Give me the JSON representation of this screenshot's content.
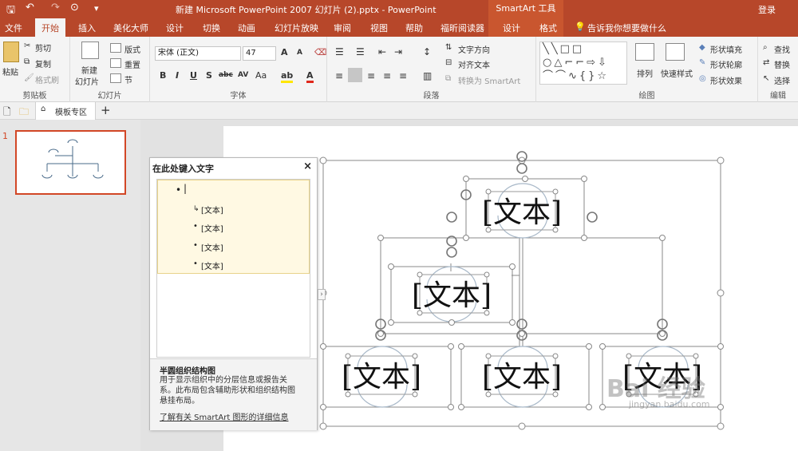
{
  "title_bar": {
    "title": "新建 Microsoft PowerPoint 2007 幻灯片 (2).pptx  -  PowerPoint",
    "context_tool": "SmartArt 工具",
    "signin": "登录"
  },
  "tabs": [
    "文件",
    "开始",
    "插入",
    "美化大师",
    "设计",
    "切换",
    "动画",
    "幻灯片放映",
    "审阅",
    "视图",
    "帮助",
    "福昕阅读器",
    "设计",
    "格式"
  ],
  "tell_me": "告诉我你想要做什么",
  "ribbon": {
    "clipboard": {
      "label": "剪贴板",
      "paste": "粘贴",
      "cut": "剪切",
      "copy": "复制",
      "painter": "格式刷"
    },
    "slides": {
      "label": "幻灯片",
      "new_slide_1": "新建",
      "new_slide_2": "幻灯片",
      "layout": "版式",
      "reset": "重置",
      "section": "节"
    },
    "font": {
      "label": "字体",
      "font_name": "宋体 (正文)",
      "font_size": "47",
      "grow": "A",
      "shrink": "A",
      "bold": "B",
      "italic": "I",
      "underline": "U",
      "shadow": "S",
      "strike": "abc",
      "spacing": "AV",
      "case": "Aa",
      "highlight": "ab",
      "color": "A"
    },
    "paragraph": {
      "label": "段落",
      "text_direction": "文字方向",
      "align_text": "对齐文本",
      "convert": "转换为 SmartArt"
    },
    "drawing": {
      "label": "绘图",
      "arrange": "排列",
      "quick_styles": "快速样式",
      "fill": "形状填充",
      "outline": "形状轮廓",
      "effects": "形状效果"
    },
    "editing": {
      "label": "编辑",
      "find": "查找",
      "replace": "替换",
      "select": "选择"
    }
  },
  "quickbar": {
    "template_zone": "模板专区",
    "add": "+"
  },
  "slide_number": "1",
  "text_pane": {
    "title": "在此处键入文字",
    "close": "×",
    "items": [
      "[文本]",
      "[文本]",
      "[文本]",
      "[文本]"
    ],
    "desc_title": "半圆组织结构图",
    "desc_body": "用于显示组织中的分层信息或报告关系。此布局包含辅助形状和组织结构图悬挂布局。",
    "desc_link": "了解有关 SmartArt 图形的详细信息"
  },
  "shape_texts": [
    "[文本]",
    "[文本]",
    "[文本]",
    "[文本]",
    "[文本]"
  ],
  "watermark": {
    "main": "Bai 经验",
    "sub": "jingyan.baidu.com"
  },
  "colors": {
    "accent": "#b7472a",
    "context": "#c9562f",
    "selection": "#d24726"
  }
}
